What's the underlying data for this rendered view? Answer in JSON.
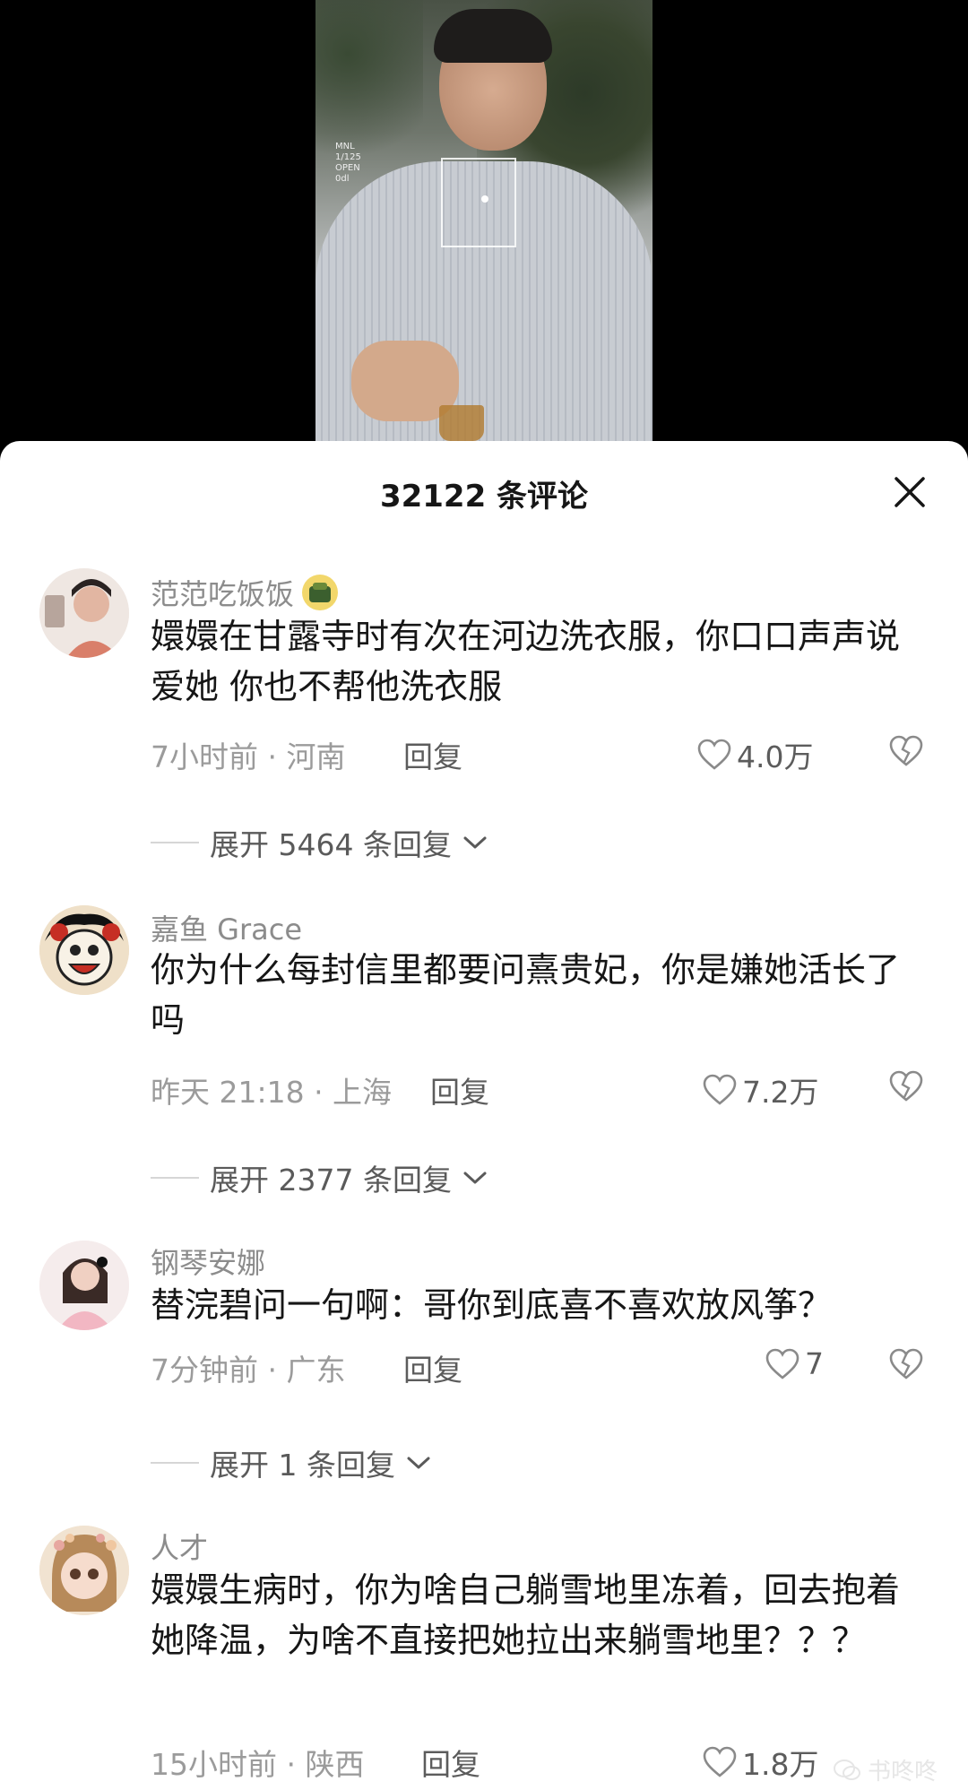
{
  "video": {
    "hud_lines": [
      "MNL",
      "1/125",
      "OPEN",
      "0dl"
    ]
  },
  "sheet": {
    "title": "32122 条评论",
    "comments": [
      {
        "author": "范范吃饭饭",
        "text": "嬛嬛在甘露寺时有次在河边洗衣服，你口口声声说爱她 你也不帮他洗衣服",
        "time_location": "7小时前 · 河南",
        "reply_label": "回复",
        "likes": "4.0万",
        "expand_label": "展开 5464 条回复",
        "has_badge": true
      },
      {
        "author": "嘉鱼 Grace",
        "text": "你为什么每封信里都要问熹贵妃，你是嫌她活长了吗",
        "time_location": "昨天 21:18 · 上海",
        "reply_label": "回复",
        "likes": "7.2万",
        "expand_label": "展开 2377 条回复"
      },
      {
        "author": "钢琴安娜",
        "text": "替浣碧问一句啊：哥你到底喜不喜欢放风筝？",
        "time_location": "7分钟前 · 广东",
        "reply_label": "回复",
        "likes": "7",
        "expand_label": "展开 1 条回复"
      },
      {
        "author": "人才",
        "text": "嬛嬛生病时，你为啥自己躺雪地里冻着，回去抱着她降温，为啥不直接把她拉出来躺雪地里？？？",
        "time_location": "15小时前 · 陕西",
        "reply_label": "回复",
        "likes": "1.8万"
      }
    ]
  },
  "watermark": "书咚咚",
  "colors": {
    "sheet_bg": "#ffffff",
    "text": "#161616",
    "muted": "#9b9b9b"
  }
}
